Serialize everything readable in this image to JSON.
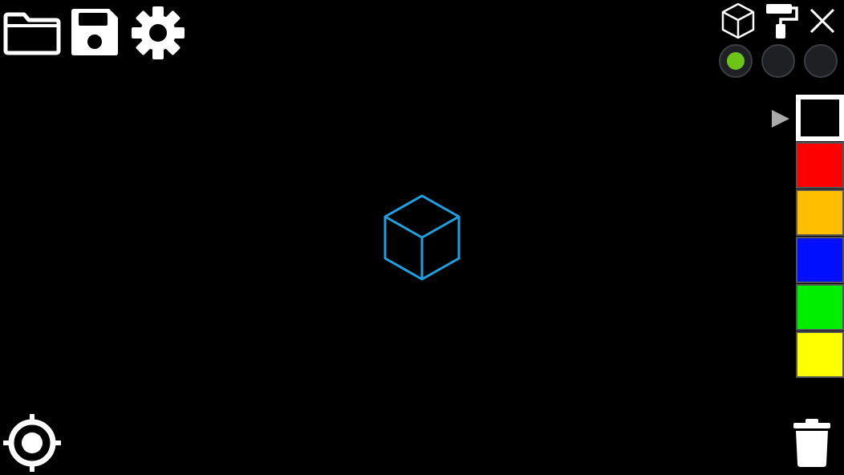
{
  "app": {
    "background_color": "#000000"
  },
  "toolbar": {
    "open_icon": "folder-icon",
    "save_icon": "floppy-disk-icon",
    "settings_icon": "gear-icon"
  },
  "mode_toolbar": {
    "cube_icon": "cube-icon",
    "paint_icon": "paint-roller-icon",
    "close_icon": "close-icon"
  },
  "layers": [
    {
      "active": true,
      "indicator_color": "#6cc417"
    },
    {
      "active": false,
      "indicator_color": ""
    },
    {
      "active": false,
      "indicator_color": ""
    }
  ],
  "palette": {
    "selected_index": 0,
    "pointer_icon": "triangle-right-icon",
    "colors": [
      "#000000",
      "#ff0000",
      "#ffbf00",
      "#0010ff",
      "#00ee00",
      "#ffff00"
    ]
  },
  "canvas": {
    "cube_outline_color": "#1da1e0"
  },
  "bottom": {
    "recenter_icon": "crosshair-icon",
    "delete_icon": "trash-icon"
  }
}
